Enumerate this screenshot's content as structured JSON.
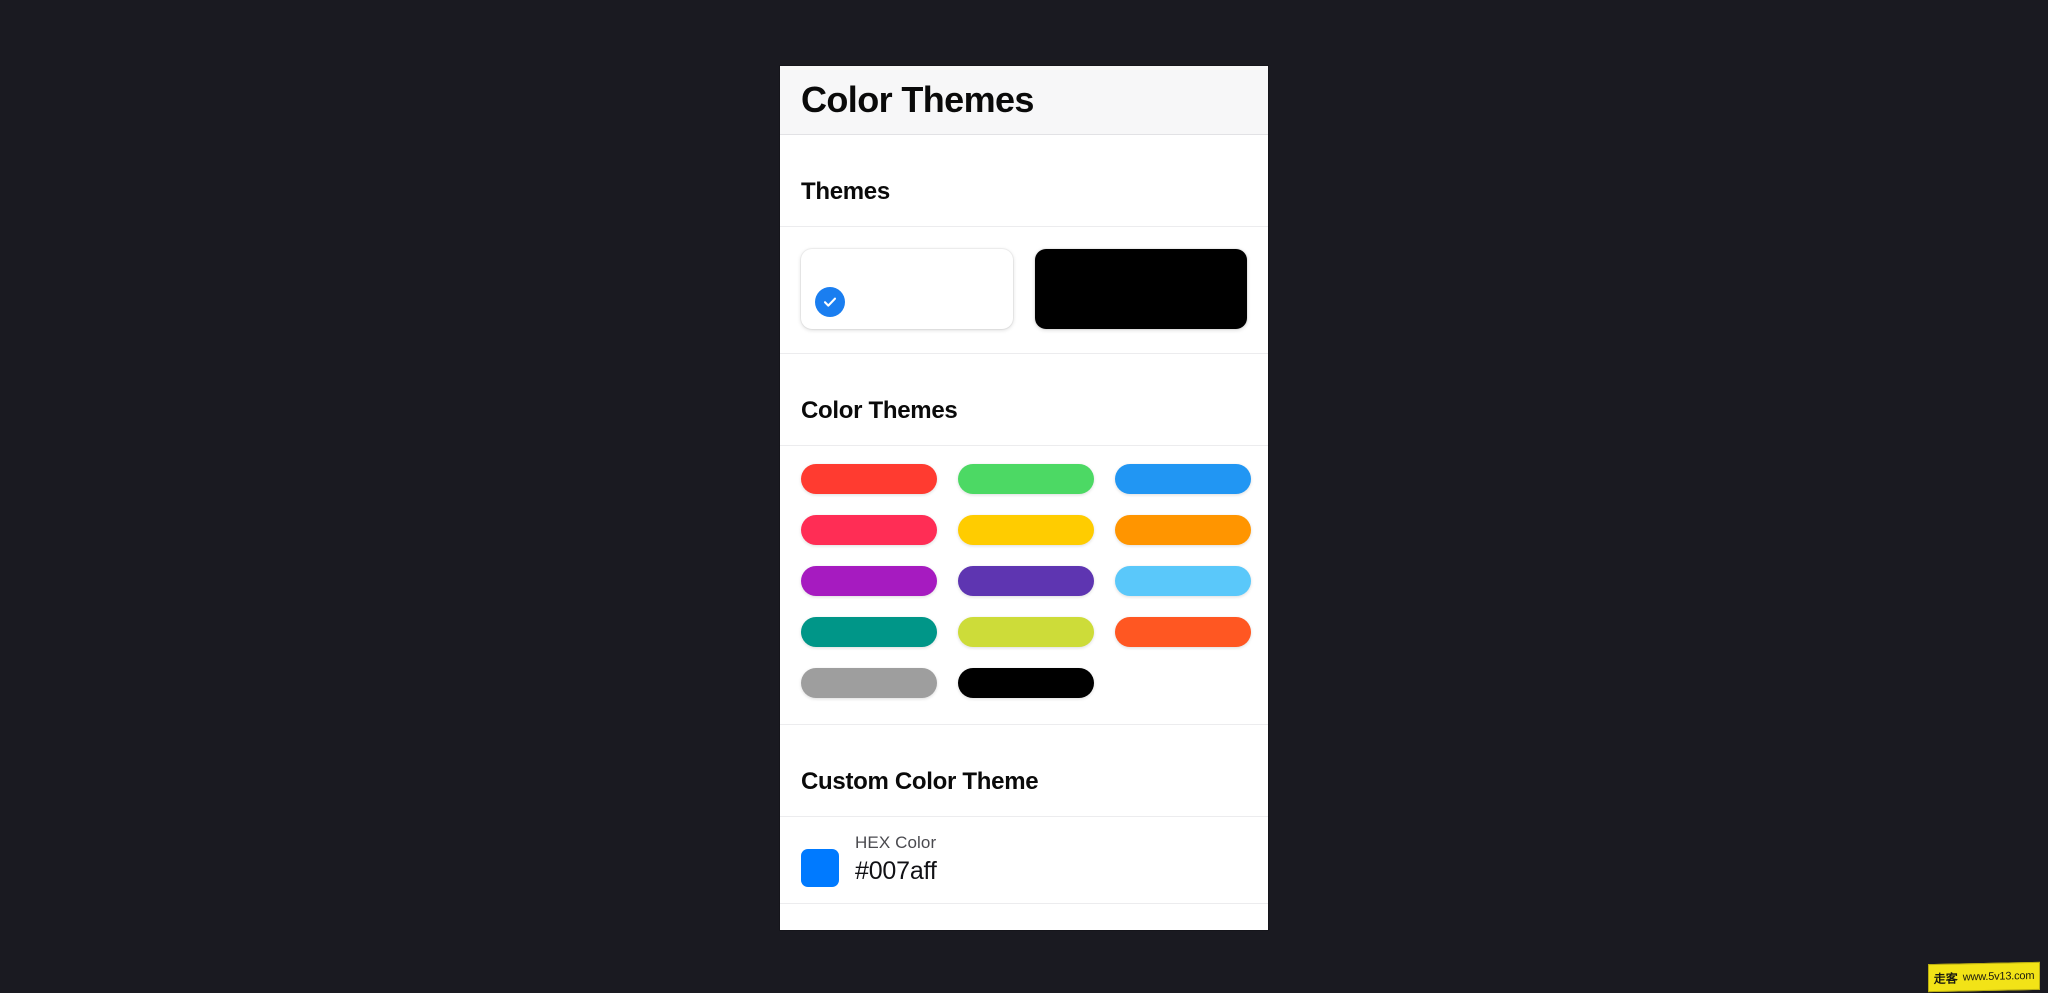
{
  "background_color": "#1a1a21",
  "header": {
    "title": "Color Themes",
    "background_color": "#f7f7f8"
  },
  "themes_section": {
    "title": "Themes",
    "cards": [
      {
        "name": "light-theme",
        "color": "#ffffff",
        "selected": true
      },
      {
        "name": "dark-theme",
        "color": "#000000",
        "selected": false
      }
    ],
    "selected_indicator_color": "#1a7ef0"
  },
  "color_themes_section": {
    "title": "Color Themes",
    "swatches": [
      {
        "name": "red",
        "color": "#ff3b30"
      },
      {
        "name": "green",
        "color": "#4cd964"
      },
      {
        "name": "blue",
        "color": "#2196f3"
      },
      {
        "name": "pink",
        "color": "#ff2d55"
      },
      {
        "name": "yellow",
        "color": "#ffcc00"
      },
      {
        "name": "orange",
        "color": "#ff9500"
      },
      {
        "name": "magenta",
        "color": "#a61bc0"
      },
      {
        "name": "deep-purple",
        "color": "#5e35b1"
      },
      {
        "name": "light-blue",
        "color": "#5ac8fa"
      },
      {
        "name": "teal",
        "color": "#009688"
      },
      {
        "name": "lime",
        "color": "#cddc39"
      },
      {
        "name": "deep-orange",
        "color": "#ff5722"
      },
      {
        "name": "grey",
        "color": "#9e9e9e"
      },
      {
        "name": "black",
        "color": "#000000"
      }
    ]
  },
  "custom_color_section": {
    "title": "Custom Color Theme",
    "hex_label": "HEX Color",
    "hex_value": "#007aff",
    "swatch_color": "#007aff"
  },
  "watermark": {
    "cn_text": "走客",
    "url_text": "www.5v13.com"
  }
}
